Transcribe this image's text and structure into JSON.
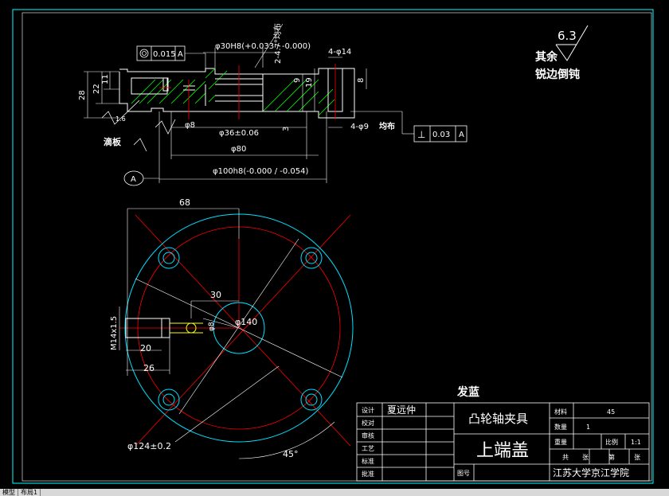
{
  "drawing": {
    "labels": {
      "roughness_value": "6.3",
      "remaining_line1": "其余",
      "remaining_line2": "锐边倒钝",
      "coax_tol": "0.015",
      "coax_datum": "A",
      "dia30": "φ30H8(+0.033 / -0.000)",
      "chamfer": "2-4.7°均布",
      "holes_4_14": "4-φ14",
      "h28": "28",
      "h22": "22",
      "h11": "11",
      "h9": "9",
      "h19": "19",
      "h8": "8",
      "ra_small": "1.6",
      "d8": "φ8",
      "d36": "φ36±0.06",
      "h3": "3",
      "holes_4_9": "4-φ9",
      "even_text": "均布",
      "perp_tol": "0.03",
      "perp_datum": "A",
      "ink_note": "滴板",
      "d80": "φ80",
      "d100": "φ100h8(-0.000 / -0.054)",
      "datum_A": "A",
      "w68": "68",
      "w30": "30",
      "d140": "φ140",
      "d8b": "φ8",
      "thread": "M14x1.5",
      "w20": "20",
      "w26": "26",
      "d124": "φ124±0.2",
      "ang45": "45°"
    },
    "blue_note": "发蓝"
  },
  "title_block": {
    "rows": [
      {
        "label": "设计",
        "value": "夏远仲"
      },
      {
        "label": "校对",
        "value": ""
      },
      {
        "label": "审核",
        "value": ""
      },
      {
        "label": "工艺",
        "value": ""
      },
      {
        "label": "标准",
        "value": ""
      },
      {
        "label": "批准",
        "value": ""
      }
    ],
    "project": "凸轮轴夹具",
    "part": "上端盖",
    "drawing_no_label": "图号",
    "material_label": "材料",
    "material": "45",
    "qty_label": "数量",
    "qty": "1",
    "weight_label": "重量",
    "scale_label": "比例",
    "scale": "1:1",
    "sheets": [
      "共",
      "张",
      "第",
      "张"
    ],
    "school": "江苏大学京江学院"
  },
  "tabs": [
    "模型",
    "布局1"
  ],
  "colors": {
    "frame": "#00ffff",
    "line": "#ffffff",
    "center": "#ff0000",
    "hatch": "#00ff00",
    "dim": "#ffffff",
    "outline_circle": "#00e0ff"
  }
}
